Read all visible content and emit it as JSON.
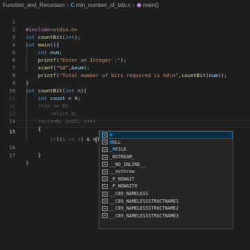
{
  "breadcrumb": {
    "folder": "Function_and_Recursion",
    "file_icon_text": "C",
    "file": "min_number_of_bits.c",
    "symbol": "main()"
  },
  "editor": {
    "active_line": 15,
    "lines": [
      {
        "n": "1"
      },
      {
        "n": "2"
      },
      {
        "n": "3"
      },
      {
        "n": "4"
      },
      {
        "n": "5"
      },
      {
        "n": "6"
      },
      {
        "n": "7"
      },
      {
        "n": "8"
      },
      {
        "n": "9"
      },
      {
        "n": "10"
      },
      {
        "n": "11"
      },
      {
        "n": "12"
      },
      {
        "n": "13"
      },
      {
        "n": "14"
      },
      {
        "n": "15"
      },
      {
        "n": "16"
      },
      {
        "n": "17"
      }
    ],
    "tokens": {
      "include": "#include",
      "header": "<stdio.h>",
      "int": "int",
      "countBit": "countBit",
      "main": "main",
      "num": "num",
      "printf": "printf",
      "scanf": "scanf",
      "str_enter": "\"Enter an Integer :\"",
      "str_fmt": "\"%d\"",
      "str_total": "\"Total number of bits required is %d\\n\"",
      "n": "n",
      "count": "count",
      "zero": "0",
      "if": "if",
      "return": "return",
      "for": "for",
      "i": "i",
      "thirtytwo": "32",
      "one": "1"
    }
  },
  "suggest": {
    "items": [
      {
        "match": "n",
        "rest": ""
      },
      {
        "match": "N",
        "rest": "ULL"
      },
      {
        "match": "_N",
        "rest": "FILE",
        "pre": ""
      },
      {
        "match": "",
        "rest": "_NSTREAM_"
      },
      {
        "match": "",
        "rest": "__NO_INLINE__"
      },
      {
        "match": "",
        "rest": "__nothrow"
      },
      {
        "match": "",
        "rest": "_P_NOWAIT"
      },
      {
        "match": "",
        "rest": "_P_NOWAITO"
      },
      {
        "match": "",
        "rest": "__C89_NAMELESS"
      },
      {
        "match": "",
        "rest": "__C89_NAMELESSSTRUCTNAME1"
      },
      {
        "match": "",
        "rest": "__C89_NAMELESSSTRUCTNAME2"
      },
      {
        "match": "",
        "rest": "__C89_NAMELESSSTRUCTNAME3"
      }
    ]
  }
}
